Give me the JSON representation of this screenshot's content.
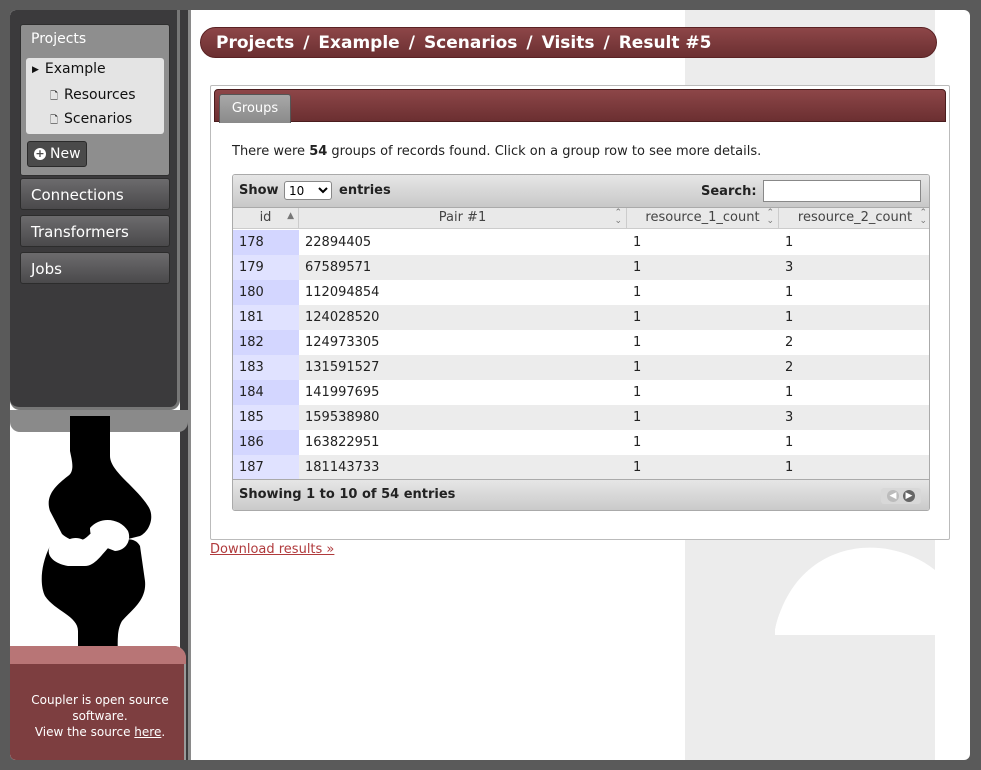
{
  "sidebar": {
    "projects_title": "Projects",
    "project_items": [
      "Example",
      "Resources",
      "Scenarios"
    ],
    "new_label": "New",
    "nav": [
      "Connections",
      "Transformers",
      "Jobs"
    ],
    "footer_line1": "Coupler is open source software.",
    "footer_line2": "View the source",
    "footer_link": "here",
    "footer_period": "."
  },
  "breadcrumb": [
    "Projects",
    "Example",
    "Scenarios",
    "Visits",
    "Result #5"
  ],
  "breadcrumb_sep": "/",
  "tab_label": "Groups",
  "info": {
    "prefix": "There were ",
    "count": "54",
    "suffix": " groups of records found. Click on a group row to see more details."
  },
  "table": {
    "show_label": "Show",
    "entries_selected": "10",
    "entries_label": "entries",
    "search_label": "Search:",
    "columns": [
      "id",
      "Pair #1",
      "resource_1_count",
      "resource_2_count"
    ],
    "rows": [
      [
        "178",
        "22894405",
        "1",
        "1"
      ],
      [
        "179",
        "67589571",
        "1",
        "3"
      ],
      [
        "180",
        "112094854",
        "1",
        "1"
      ],
      [
        "181",
        "124028520",
        "1",
        "1"
      ],
      [
        "182",
        "124973305",
        "1",
        "2"
      ],
      [
        "183",
        "131591527",
        "1",
        "2"
      ],
      [
        "184",
        "141997695",
        "1",
        "1"
      ],
      [
        "185",
        "159538980",
        "1",
        "3"
      ],
      [
        "186",
        "163822951",
        "1",
        "1"
      ],
      [
        "187",
        "181143733",
        "1",
        "1"
      ]
    ],
    "status": "Showing 1 to 10 of 54 entries"
  },
  "download_label": "Download results »",
  "colors": {
    "accent": "#7d3e40",
    "sidebar_bg": "#3b3a3c",
    "id_highlight": "#d3d6ff"
  }
}
